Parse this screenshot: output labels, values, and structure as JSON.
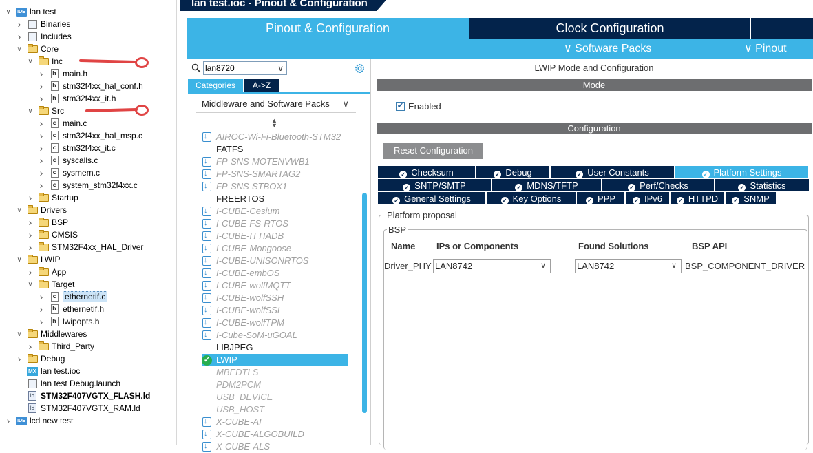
{
  "explorer": {
    "items": [
      {
        "label": "lan test",
        "depth": 0,
        "icon": "ide-project-icon",
        "expanded": true
      },
      {
        "label": "Binaries",
        "depth": 1,
        "icon": "binaries-icon",
        "expanded": false
      },
      {
        "label": "Includes",
        "depth": 1,
        "icon": "includes-icon",
        "expanded": false
      },
      {
        "label": "Core",
        "depth": 1,
        "icon": "folder-icon",
        "expanded": true
      },
      {
        "label": "Inc",
        "depth": 2,
        "icon": "folder-icon",
        "expanded": true
      },
      {
        "label": "main.h",
        "depth": 3,
        "icon": "h-file-icon",
        "expanded": false
      },
      {
        "label": "stm32f4xx_hal_conf.h",
        "depth": 3,
        "icon": "h-file-icon",
        "expanded": false
      },
      {
        "label": "stm32f4xx_it.h",
        "depth": 3,
        "icon": "h-file-icon",
        "expanded": false
      },
      {
        "label": "Src",
        "depth": 2,
        "icon": "folder-icon",
        "expanded": true
      },
      {
        "label": "main.c",
        "depth": 3,
        "icon": "c-file-icon",
        "expanded": false
      },
      {
        "label": "stm32f4xx_hal_msp.c",
        "depth": 3,
        "icon": "c-file-icon",
        "expanded": false
      },
      {
        "label": "stm32f4xx_it.c",
        "depth": 3,
        "icon": "c-file-icon",
        "expanded": false
      },
      {
        "label": "syscalls.c",
        "depth": 3,
        "icon": "c-file-icon",
        "expanded": false
      },
      {
        "label": "sysmem.c",
        "depth": 3,
        "icon": "c-file-icon",
        "expanded": false
      },
      {
        "label": "system_stm32f4xx.c",
        "depth": 3,
        "icon": "c-file-icon",
        "expanded": false
      },
      {
        "label": "Startup",
        "depth": 2,
        "icon": "folder-icon",
        "expanded": false
      },
      {
        "label": "Drivers",
        "depth": 1,
        "icon": "folder-icon",
        "expanded": true
      },
      {
        "label": "BSP",
        "depth": 2,
        "icon": "folder-icon",
        "expanded": false
      },
      {
        "label": "CMSIS",
        "depth": 2,
        "icon": "folder-icon",
        "expanded": false
      },
      {
        "label": "STM32F4xx_HAL_Driver",
        "depth": 2,
        "icon": "folder-icon",
        "expanded": false
      },
      {
        "label": "LWIP",
        "depth": 1,
        "icon": "folder-icon",
        "expanded": true
      },
      {
        "label": "App",
        "depth": 2,
        "icon": "folder-icon",
        "expanded": false
      },
      {
        "label": "Target",
        "depth": 2,
        "icon": "folder-icon",
        "expanded": true
      },
      {
        "label": "ethernetif.c",
        "depth": 3,
        "icon": "c-file-icon",
        "expanded": false,
        "selected": true
      },
      {
        "label": "ethernetif.h",
        "depth": 3,
        "icon": "h-file-icon",
        "expanded": false
      },
      {
        "label": "lwipopts.h",
        "depth": 3,
        "icon": "h-file-icon",
        "expanded": false
      },
      {
        "label": "Middlewares",
        "depth": 1,
        "icon": "folder-icon",
        "expanded": true
      },
      {
        "label": "Third_Party",
        "depth": 2,
        "icon": "folder-icon",
        "expanded": false
      },
      {
        "label": "Debug",
        "depth": 1,
        "icon": "folder-icon",
        "expanded": false
      },
      {
        "label": "lan test.ioc",
        "depth": 1,
        "icon": "mx-file-icon",
        "leaf": true
      },
      {
        "label": "lan test Debug.launch",
        "depth": 1,
        "icon": "launch-file-icon",
        "leaf": true
      },
      {
        "label": "STM32F407VGTX_FLASH.ld",
        "depth": 1,
        "icon": "ld-file-icon",
        "leaf": true,
        "bold": true
      },
      {
        "label": "STM32F407VGTX_RAM.ld",
        "depth": 1,
        "icon": "ld-file-icon",
        "leaf": true
      },
      {
        "label": "lcd new test",
        "depth": 0,
        "icon": "ide-project-icon",
        "expanded": false
      }
    ]
  },
  "editor_title": "lan test.ioc - Pinout & Configuration",
  "main_tabs": {
    "pinout": "Pinout & Configuration",
    "clock": "Clock Configuration"
  },
  "subbar": {
    "software_packs": "Software Packs",
    "pinout": "Pinout"
  },
  "categories": {
    "search_value": "lan8720",
    "tab_categories": "Categories",
    "tab_az": "A->Z",
    "group_header": "Middleware and Software Packs",
    "packs": [
      {
        "label": "AIROC-Wi-Fi-Bluetooth-STM32",
        "kind": "gray"
      },
      {
        "label": "FATFS",
        "kind": "plain"
      },
      {
        "label": "FP-SNS-MOTENVWB1",
        "kind": "gray"
      },
      {
        "label": "FP-SNS-SMARTAG2",
        "kind": "gray"
      },
      {
        "label": "FP-SNS-STBOX1",
        "kind": "gray"
      },
      {
        "label": "FREERTOS",
        "kind": "plain"
      },
      {
        "label": "I-CUBE-Cesium",
        "kind": "gray"
      },
      {
        "label": "I-CUBE-FS-RTOS",
        "kind": "gray"
      },
      {
        "label": "I-CUBE-ITTIADB",
        "kind": "gray"
      },
      {
        "label": "I-CUBE-Mongoose",
        "kind": "gray"
      },
      {
        "label": "I-CUBE-UNISONRTOS",
        "kind": "gray"
      },
      {
        "label": "I-CUBE-embOS",
        "kind": "gray"
      },
      {
        "label": "I-CUBE-wolfMQTT",
        "kind": "gray"
      },
      {
        "label": "I-CUBE-wolfSSH",
        "kind": "gray"
      },
      {
        "label": "I-CUBE-wolfSSL",
        "kind": "gray"
      },
      {
        "label": "I-CUBE-wolfTPM",
        "kind": "gray"
      },
      {
        "label": "I-Cube-SoM-uGOAL",
        "kind": "gray"
      },
      {
        "label": "LIBJPEG",
        "kind": "plain"
      },
      {
        "label": "LWIP",
        "kind": "selected"
      },
      {
        "label": "MBEDTLS",
        "kind": "dim"
      },
      {
        "label": "PDM2PCM",
        "kind": "dim"
      },
      {
        "label": "USB_DEVICE",
        "kind": "dim"
      },
      {
        "label": "USB_HOST",
        "kind": "dim"
      },
      {
        "label": "X-CUBE-AI",
        "kind": "gray"
      },
      {
        "label": "X-CUBE-ALGOBUILD",
        "kind": "gray"
      },
      {
        "label": "X-CUBE-ALS",
        "kind": "gray"
      }
    ]
  },
  "config": {
    "title": "LWIP Mode and Configuration",
    "mode_header": "Mode",
    "enabled_label": "Enabled",
    "configuration_header": "Configuration",
    "reset_label": "Reset Configuration",
    "tabs_row1": [
      "Checksum",
      "Debug",
      "User Constants",
      "Platform Settings"
    ],
    "tabs_row2": [
      "SNTP/SMTP",
      "MDNS/TFTP",
      "Perf/Checks",
      "Statistics"
    ],
    "tabs_row3": [
      "General Settings",
      "Key Options",
      "PPP",
      "IPv6",
      "HTTPD",
      "SNMP"
    ],
    "active_tab": "Platform Settings",
    "platform_legend": "Platform proposal",
    "bsp_legend": "BSP",
    "columns": {
      "name": "Name",
      "ips": "IPs or Components",
      "found": "Found Solutions",
      "api": "BSP API"
    },
    "row": {
      "name": "Driver_PHY",
      "ip_value": "LAN8742",
      "found_value": "LAN8742",
      "api": "BSP_COMPONENT_DRIVER"
    }
  },
  "colors": {
    "accent": "#3cb4e6",
    "navy": "#03234b",
    "grey_header": "#6d6e70",
    "annotation_red": "#e04444"
  }
}
